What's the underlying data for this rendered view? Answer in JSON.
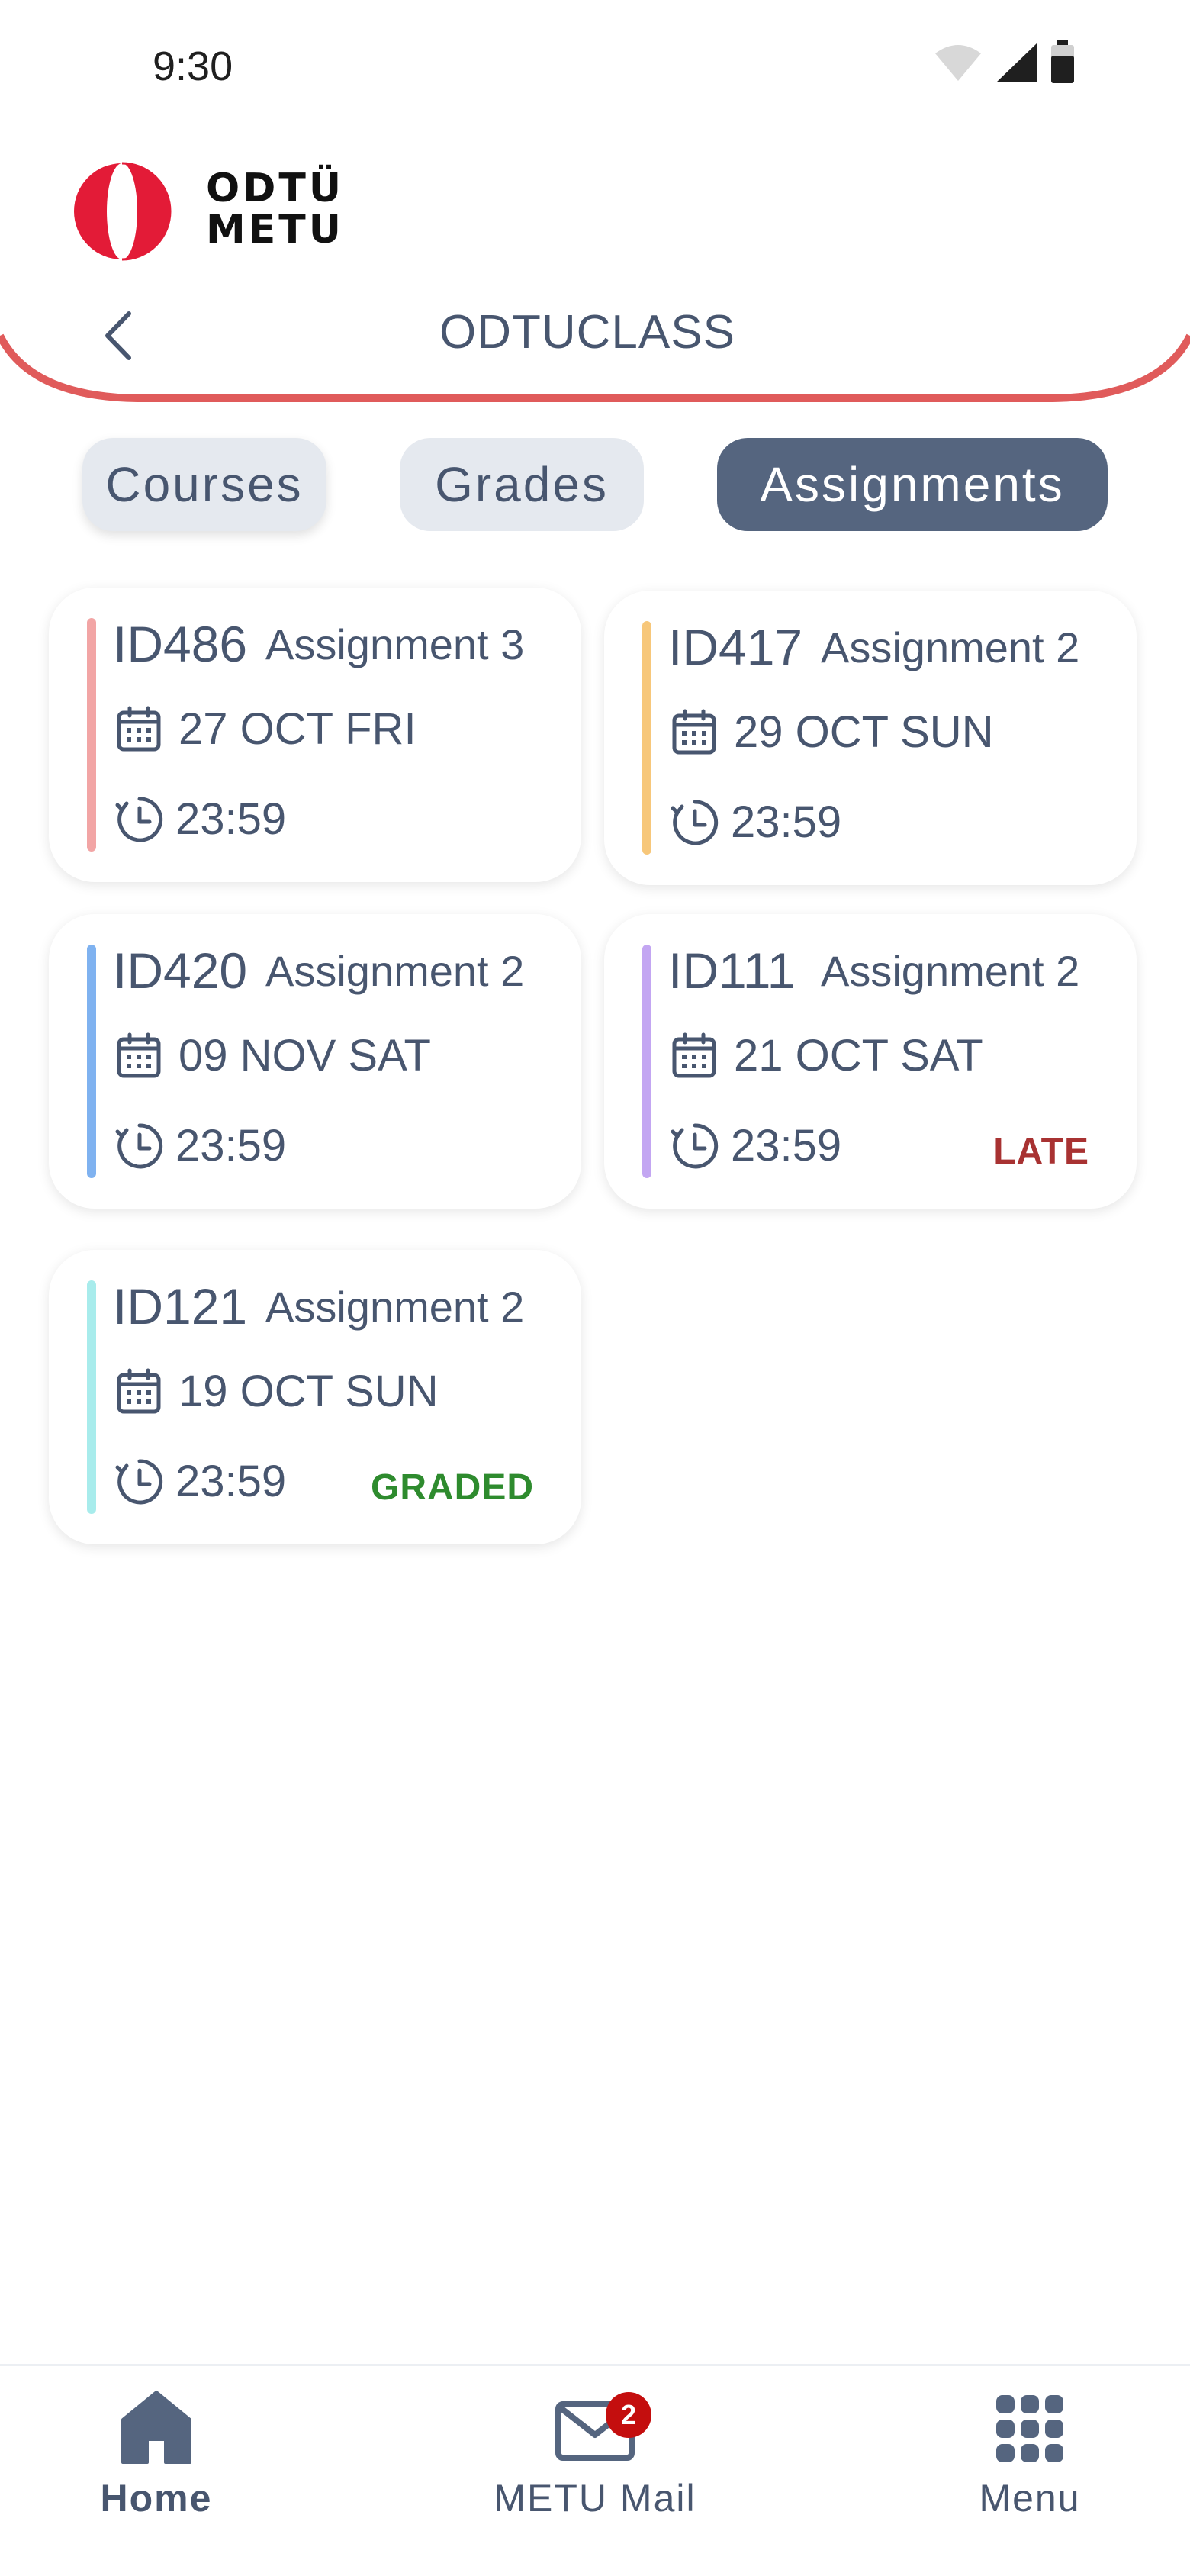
{
  "status_bar": {
    "time": "9:30"
  },
  "header": {
    "logo_line1": "ODTÜ",
    "logo_line2": "METU",
    "title": "ODTUCLASS"
  },
  "tabs": [
    {
      "label": "Courses",
      "active": false
    },
    {
      "label": "Grades",
      "active": false
    },
    {
      "label": "Assignments",
      "active": true
    }
  ],
  "assignments": [
    {
      "id": "ID486",
      "name": "Assignment 3",
      "date": "27 OCT FRI",
      "time": "23:59",
      "status": "",
      "accent": "#f2a5a5"
    },
    {
      "id": "ID417",
      "name": "Assignment 2",
      "date": "29 OCT SUN",
      "time": "23:59",
      "status": "",
      "accent": "#f7c77a"
    },
    {
      "id": "ID420",
      "name": "Assignment 2",
      "date": "09 NOV SAT",
      "time": "23:59",
      "status": "",
      "accent": "#7fb2f0"
    },
    {
      "id": "ID111",
      "name": "Assignment 2",
      "date": "21 OCT SAT",
      "time": "23:59",
      "status": "LATE",
      "accent": "#c3a6f2"
    },
    {
      "id": "ID121",
      "name": "Assignment 2",
      "date": "19 OCT SUN",
      "time": "23:59",
      "status": "GRADED",
      "accent": "#a8ecec"
    }
  ],
  "status_colors": {
    "LATE": "#a83232",
    "GRADED": "#2e8b2e"
  },
  "bottom_nav": {
    "home_label": "Home",
    "mail_label": "METU Mail",
    "mail_badge": "2",
    "menu_label": "Menu"
  },
  "colors": {
    "primary": "#55657f",
    "text": "#48566f",
    "accent_red": "#e05b5b",
    "logo_red": "#e31b37"
  }
}
